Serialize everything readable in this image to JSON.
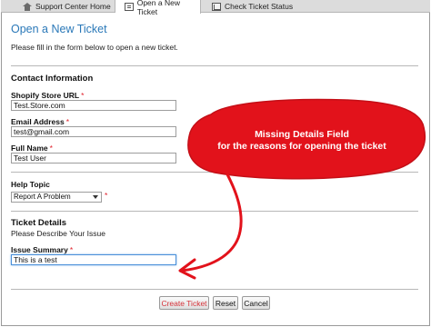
{
  "tabs": [
    {
      "label": "Support Center Home",
      "icon": "home-icon"
    },
    {
      "label": "Open a New Ticket",
      "icon": "ticket-icon",
      "active": true
    },
    {
      "label": "Check Ticket Status",
      "icon": "status-icon"
    }
  ],
  "page": {
    "title": "Open a New Ticket",
    "intro": "Please fill in the form below to open a new ticket."
  },
  "contact": {
    "section_title": "Contact Information",
    "store_url_label": "Shopify Store URL",
    "store_url_value": "Test.Store.com",
    "email_label": "Email Address",
    "email_value": "test@gmail.com",
    "name_label": "Full Name",
    "name_value": "Test User",
    "required_mark": "*"
  },
  "help": {
    "label": "Help Topic",
    "selected": "Report A Problem",
    "required_mark": "*"
  },
  "ticket": {
    "section_title": "Ticket Details",
    "describe": "Please Describe Your Issue",
    "summary_label": "Issue Summary",
    "summary_value": "This is a test",
    "required_mark": "*"
  },
  "buttons": {
    "create": "Create Ticket",
    "reset": "Reset",
    "cancel": "Cancel"
  },
  "annotation": {
    "line1": "Missing Details Field",
    "line2": "for the reasons for opening the ticket",
    "color": "#e2121b"
  },
  "colors": {
    "title_blue": "#2a78b8",
    "required_red": "#e0202a"
  }
}
